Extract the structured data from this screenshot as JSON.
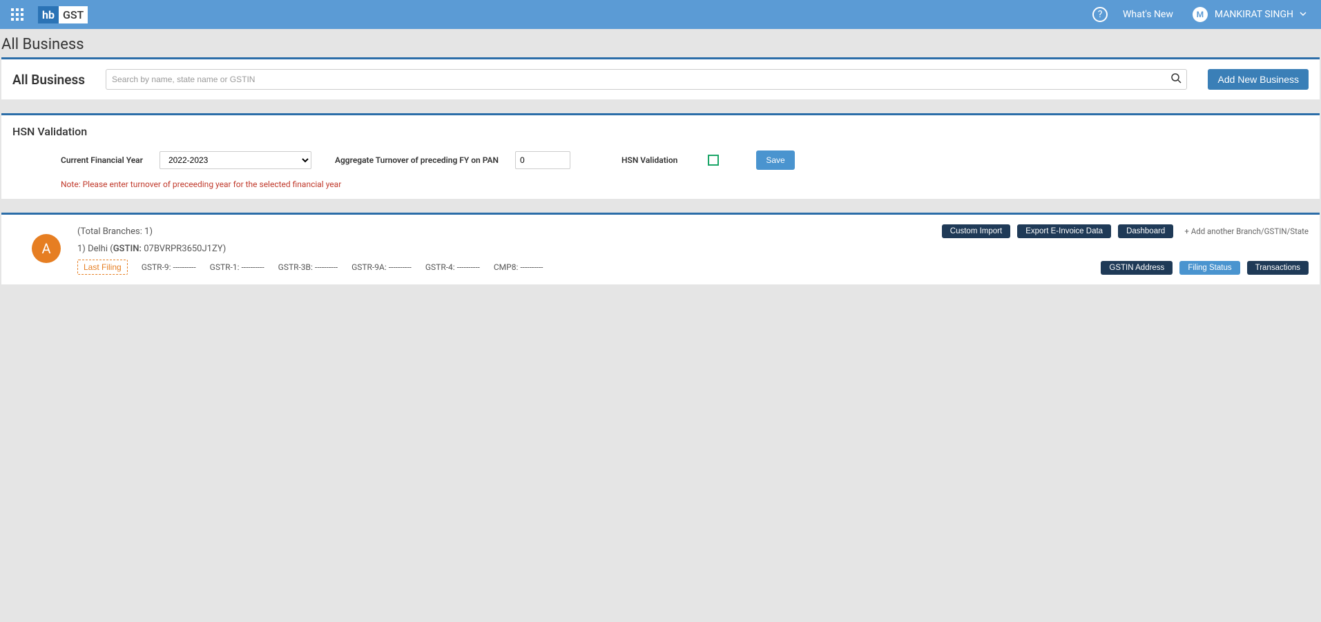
{
  "header": {
    "logo_left": "hb",
    "logo_right": "GST",
    "help_glyph": "?",
    "whats_new": "What's New",
    "user_initial": "M",
    "user_name": "MANKIRAT SINGH"
  },
  "page": {
    "title": "All Business"
  },
  "search_panel": {
    "heading": "All Business",
    "placeholder": "Search by name, state name or GSTIN",
    "add_button": "Add New Business"
  },
  "hsn": {
    "heading": "HSN Validation",
    "fy_label": "Current Financial Year",
    "fy_value": "2022-2023",
    "turnover_label": "Aggregate Turnover of preceding FY on PAN",
    "turnover_value": "0",
    "hsn_label": "HSN Validation",
    "save_label": "Save",
    "note": "Note: Please enter turnover of preceeding year for the selected financial year"
  },
  "business": {
    "total_branches": "(Total Branches: 1)",
    "actions_top": {
      "custom_import": "Custom Import",
      "export_einvoice": "Export E-Invoice Data",
      "dashboard": "Dashboard",
      "add_branch": "+ Add another Branch/GSTIN/State"
    },
    "branch": {
      "index": "1)",
      "state": "Delhi",
      "gstin_label": "GSTIN:",
      "gstin_value": "07BVRPR3650J1ZY"
    },
    "filing": {
      "last_filing_label": "Last Filing",
      "items": [
        "GSTR-9: ----------",
        "GSTR-1: ----------",
        "GSTR-3B: ----------",
        "GSTR-9A: ----------",
        "GSTR-4: ----------",
        "CMP8: ----------"
      ]
    },
    "actions_bottom": {
      "gstin_address": "GSTIN Address",
      "filing_status": "Filing Status",
      "transactions": "Transactions"
    },
    "avatar_letter": "A"
  }
}
